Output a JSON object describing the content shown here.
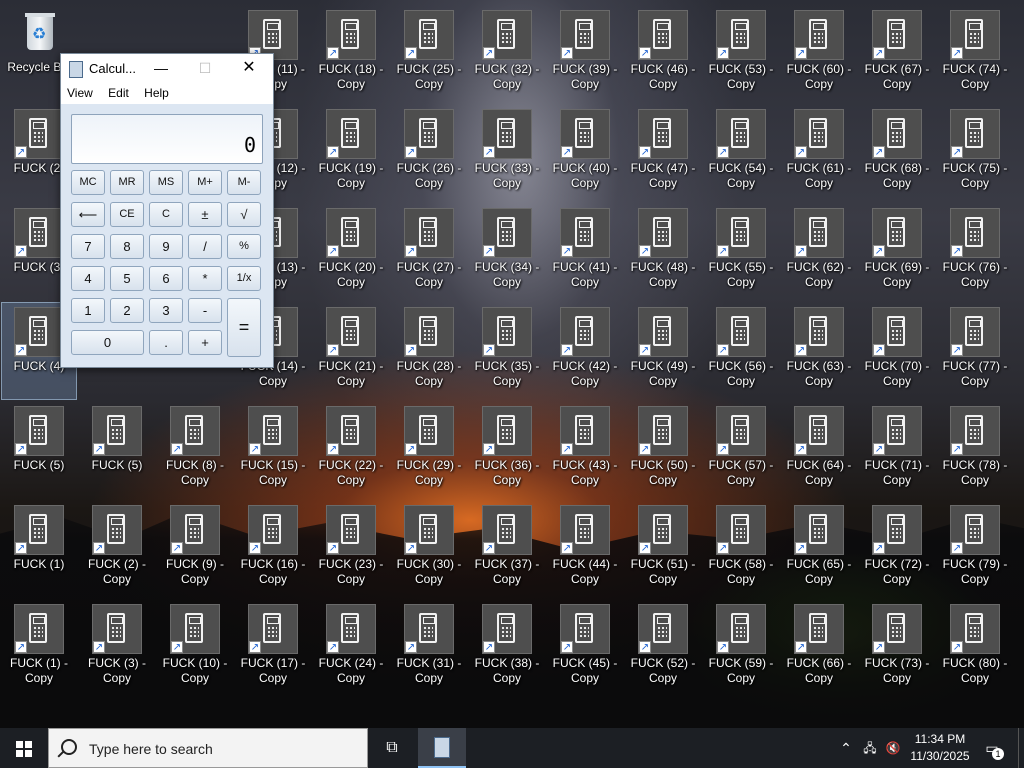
{
  "desktop": {
    "recycle_bin": {
      "label": "Recycle Bin",
      "icon": "recycle-bin-icon"
    },
    "icons": [
      {
        "label": "FUCK (2)"
      },
      {
        "label": "FUCK (3)"
      },
      {
        "label": "FUCK (4)"
      },
      {
        "label": "FUCK (5)"
      },
      {
        "label": "FUCK (1)"
      },
      {
        "label": "FUCK (1) - Copy"
      },
      {
        "label": "FUCK (5)"
      },
      {
        "label": "FUCK (2) - Copy"
      },
      {
        "label": "FUCK (3) - Copy"
      },
      {
        "label": "FUCK (8) - Copy"
      },
      {
        "label": "FUCK (9) - Copy"
      },
      {
        "label": "FUCK (10) - Copy"
      },
      {
        "label": "FUCK (11) - Copy"
      },
      {
        "label": "FUCK (12) - Copy"
      },
      {
        "label": "FUCK (13) - Copy"
      },
      {
        "label": "FUCK (14) - Copy"
      },
      {
        "label": "FUCK (15) - Copy"
      },
      {
        "label": "FUCK (16) - Copy"
      },
      {
        "label": "FUCK (17) - Copy"
      },
      {
        "label": "FUCK (18) - Copy"
      },
      {
        "label": "FUCK (19) - Copy"
      },
      {
        "label": "FUCK (20) - Copy"
      },
      {
        "label": "FUCK (21) - Copy"
      },
      {
        "label": "FUCK (22) - Copy"
      },
      {
        "label": "FUCK (23) - Copy"
      },
      {
        "label": "FUCK (24) - Copy"
      },
      {
        "label": "FUCK (25) - Copy"
      },
      {
        "label": "FUCK (26) - Copy"
      },
      {
        "label": "FUCK (27) - Copy"
      },
      {
        "label": "FUCK (28) - Copy"
      },
      {
        "label": "FUCK (29) - Copy"
      },
      {
        "label": "FUCK (30) - Copy"
      },
      {
        "label": "FUCK (31) - Copy"
      },
      {
        "label": "FUCK (32) - Copy"
      },
      {
        "label": "FUCK (33) - Copy"
      },
      {
        "label": "FUCK (34) - Copy"
      },
      {
        "label": "FUCK (35) - Copy"
      },
      {
        "label": "FUCK (36) - Copy"
      },
      {
        "label": "FUCK (37) - Copy"
      },
      {
        "label": "FUCK (38) - Copy"
      },
      {
        "label": "FUCK (39) - Copy"
      },
      {
        "label": "FUCK (40) - Copy"
      },
      {
        "label": "FUCK (41) - Copy"
      },
      {
        "label": "FUCK (42) - Copy"
      },
      {
        "label": "FUCK (43) - Copy"
      },
      {
        "label": "FUCK (44) - Copy"
      },
      {
        "label": "FUCK (45) - Copy"
      },
      {
        "label": "FUCK (46) - Copy"
      },
      {
        "label": "FUCK (47) - Copy"
      },
      {
        "label": "FUCK (48) - Copy"
      },
      {
        "label": "FUCK (49) - Copy"
      },
      {
        "label": "FUCK (50) - Copy"
      },
      {
        "label": "FUCK (51) - Copy"
      },
      {
        "label": "FUCK (52) - Copy"
      },
      {
        "label": "FUCK (53) - Copy"
      },
      {
        "label": "FUCK (54) - Copy"
      },
      {
        "label": "FUCK (55) - Copy"
      },
      {
        "label": "FUCK (56) - Copy"
      },
      {
        "label": "FUCK (57) - Copy"
      },
      {
        "label": "FUCK (58) - Copy"
      },
      {
        "label": "FUCK (59) - Copy"
      },
      {
        "label": "FUCK (60) - Copy"
      },
      {
        "label": "FUCK (61) - Copy"
      },
      {
        "label": "FUCK (62) - Copy"
      },
      {
        "label": "FUCK (63) - Copy"
      },
      {
        "label": "FUCK (64) - Copy"
      },
      {
        "label": "FUCK (65) - Copy"
      },
      {
        "label": "FUCK (66) - Copy"
      },
      {
        "label": "FUCK (67) - Copy"
      },
      {
        "label": "FUCK (68) - Copy"
      },
      {
        "label": "FUCK (69) - Copy"
      },
      {
        "label": "FUCK (70) - Copy"
      },
      {
        "label": "FUCK (71) - Copy"
      },
      {
        "label": "FUCK (72) - Copy"
      },
      {
        "label": "FUCK (73) - Copy"
      },
      {
        "label": "FUCK (74) - Copy"
      },
      {
        "label": "FUCK (75) - Copy"
      },
      {
        "label": "FUCK (76) - Copy"
      },
      {
        "label": "FUCK (77) - Copy"
      },
      {
        "label": "FUCK (78) - Copy"
      },
      {
        "label": "FUCK (79) - Copy"
      },
      {
        "label": "FUCK (80) - Copy"
      }
    ]
  },
  "calculator": {
    "title": "Calcul...",
    "menu": [
      "View",
      "Edit",
      "Help"
    ],
    "display": "0",
    "keys": {
      "mc": "MC",
      "mr": "MR",
      "ms": "MS",
      "mplus": "M+",
      "mminus": "M-",
      "back": "⟵",
      "ce": "CE",
      "c": "C",
      "plusminus": "±",
      "sqrt": "√",
      "7": "7",
      "8": "8",
      "9": "9",
      "div": "/",
      "pct": "%",
      "4": "4",
      "5": "5",
      "6": "6",
      "mul": "*",
      "recip": "1/x",
      "1": "1",
      "2": "2",
      "3": "3",
      "sub": "-",
      "eq": "=",
      "0": "0",
      "dot": ".",
      "add": "+"
    },
    "window_controls": {
      "minimize": "—",
      "maximize": "☐",
      "close": "✕"
    }
  },
  "taskbar": {
    "search_placeholder": "Type here to search",
    "clock_time": "11:34 PM",
    "clock_date": "11/30/2025",
    "notification_count": "1",
    "icons": {
      "start": "windows-logo-icon",
      "task_view": "task-view-icon",
      "calculator": "calculator-icon",
      "chevron": "chevron-up-icon",
      "network": "network-icon",
      "volume": "volume-muted-icon",
      "notifications": "action-center-icon"
    }
  }
}
